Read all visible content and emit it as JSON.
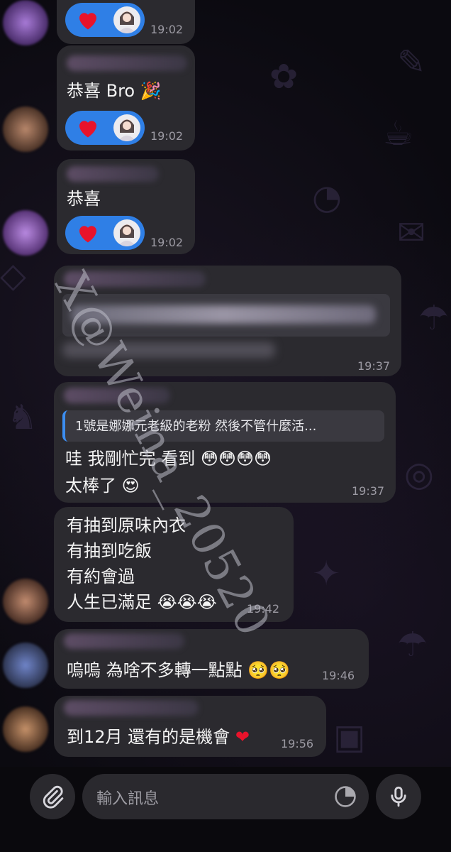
{
  "messages": [
    {
      "text": "",
      "time": "19:02",
      "reaction": true
    },
    {
      "text": "恭喜 Bro",
      "time": "19:02",
      "reaction": true
    },
    {
      "text": "恭喜",
      "time": "19:02",
      "reaction": true
    },
    {
      "text": "",
      "time": "19:37",
      "redacted": true
    },
    {
      "quote": "1號是娜娜元老級的老粉 然後不管什麼活...",
      "lines": [
        "哇 我剛忙完 看到",
        "太棒了"
      ],
      "time": "19:37"
    },
    {
      "lines": [
        "有抽到原味內衣",
        "有抽到吃飯",
        "有約會過",
        "人生已滿足"
      ],
      "time": "19:42"
    },
    {
      "text": "嗚嗚 為啥不多轉一點點",
      "time": "19:46"
    },
    {
      "text": "到12月 還有的是機會",
      "time": "19:56"
    }
  ],
  "input": {
    "placeholder": "輸入訊息"
  },
  "watermark": "X@Weina_20520",
  "icons": {
    "attach": "paperclip-icon",
    "sticker": "sticker-icon",
    "mic": "microphone-icon"
  },
  "colors": {
    "bubble": "#2b2a2f",
    "reaction": "#2f7fe6",
    "quote_bar": "#3c8df0",
    "background": "#0b0a10"
  }
}
